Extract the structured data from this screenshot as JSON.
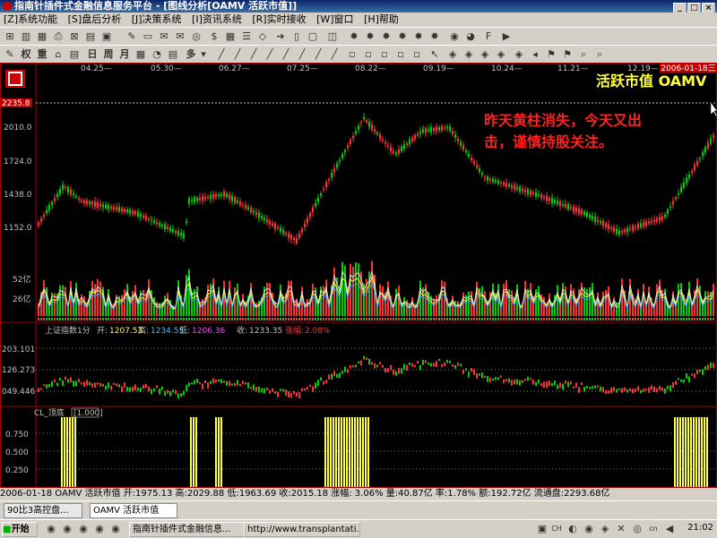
{
  "window": {
    "title": "指南针插件式金融信息服务平台 - [图线分析[OAMV 活跃市值]]"
  },
  "menu": [
    "[Z]系统功能",
    "[S]盘后分析",
    "[J]决策系统",
    "[I]资讯系统",
    "[R]实时接收",
    "[W]窗口",
    "[H]帮助"
  ],
  "toolbar2": {
    "quan": "权",
    "zhong": "重",
    "day": "日",
    "week": "周",
    "month": "月",
    "duo": "多"
  },
  "date_axis": [
    "04.25—",
    "05.30—",
    "06.27—",
    "07.25—",
    "08.22—",
    "09.19—",
    "10.24—",
    "11.21—",
    "12.19—"
  ],
  "current_date": "2006-01-18三",
  "indicator_title": "活跃市值  OAMV",
  "annotation": "昨天黄柱消失，今天又出击，谨慎持股关注。",
  "main_pane": {
    "cursor_value": "2235.8",
    "y_labels": [
      "2010.0",
      "1724.0",
      "1438.0",
      "1152.0"
    ]
  },
  "volume_pane": {
    "y_labels": [
      "52亿",
      "26亿"
    ]
  },
  "index_pane": {
    "name": "上证指数1分",
    "open_label": "开:",
    "open": "1207.53",
    "high_label": "高:",
    "high": "1234.53",
    "low_label": "低:",
    "low": "1206.36",
    "close_label": "收:",
    "close": "1233.35",
    "chg_label": "涨幅:",
    "chg": "2.08%",
    "y_labels": [
      "203.101",
      "126.273",
      "049.446"
    ]
  },
  "signal_pane": {
    "name": "CL_顶底",
    "value": "1.000",
    "y_labels": [
      "0.750",
      "0.500",
      "0.250"
    ]
  },
  "status_line": "2006-01-18 OAMV 活跃市值  开:1975.13 高:2029.88 低:1963.69 收:2015.18 涨幅: 3.06% 量:40.87亿 率:1.78% 额:192.72亿 流通盘:2293.68亿",
  "doc_tabs": [
    "90比3高控盘...",
    "OAMV 活跃市值"
  ],
  "taskbar": {
    "start": "开始",
    "tasks": [
      "指南针插件式金融信息...",
      "http://www.transplantati..."
    ],
    "clock": "21:02"
  },
  "colors": {
    "up": "#ff3030",
    "down": "#00d000",
    "signal": "#ffff40",
    "annotation": "#ff2020",
    "indicator_title": "#ffff40"
  }
}
